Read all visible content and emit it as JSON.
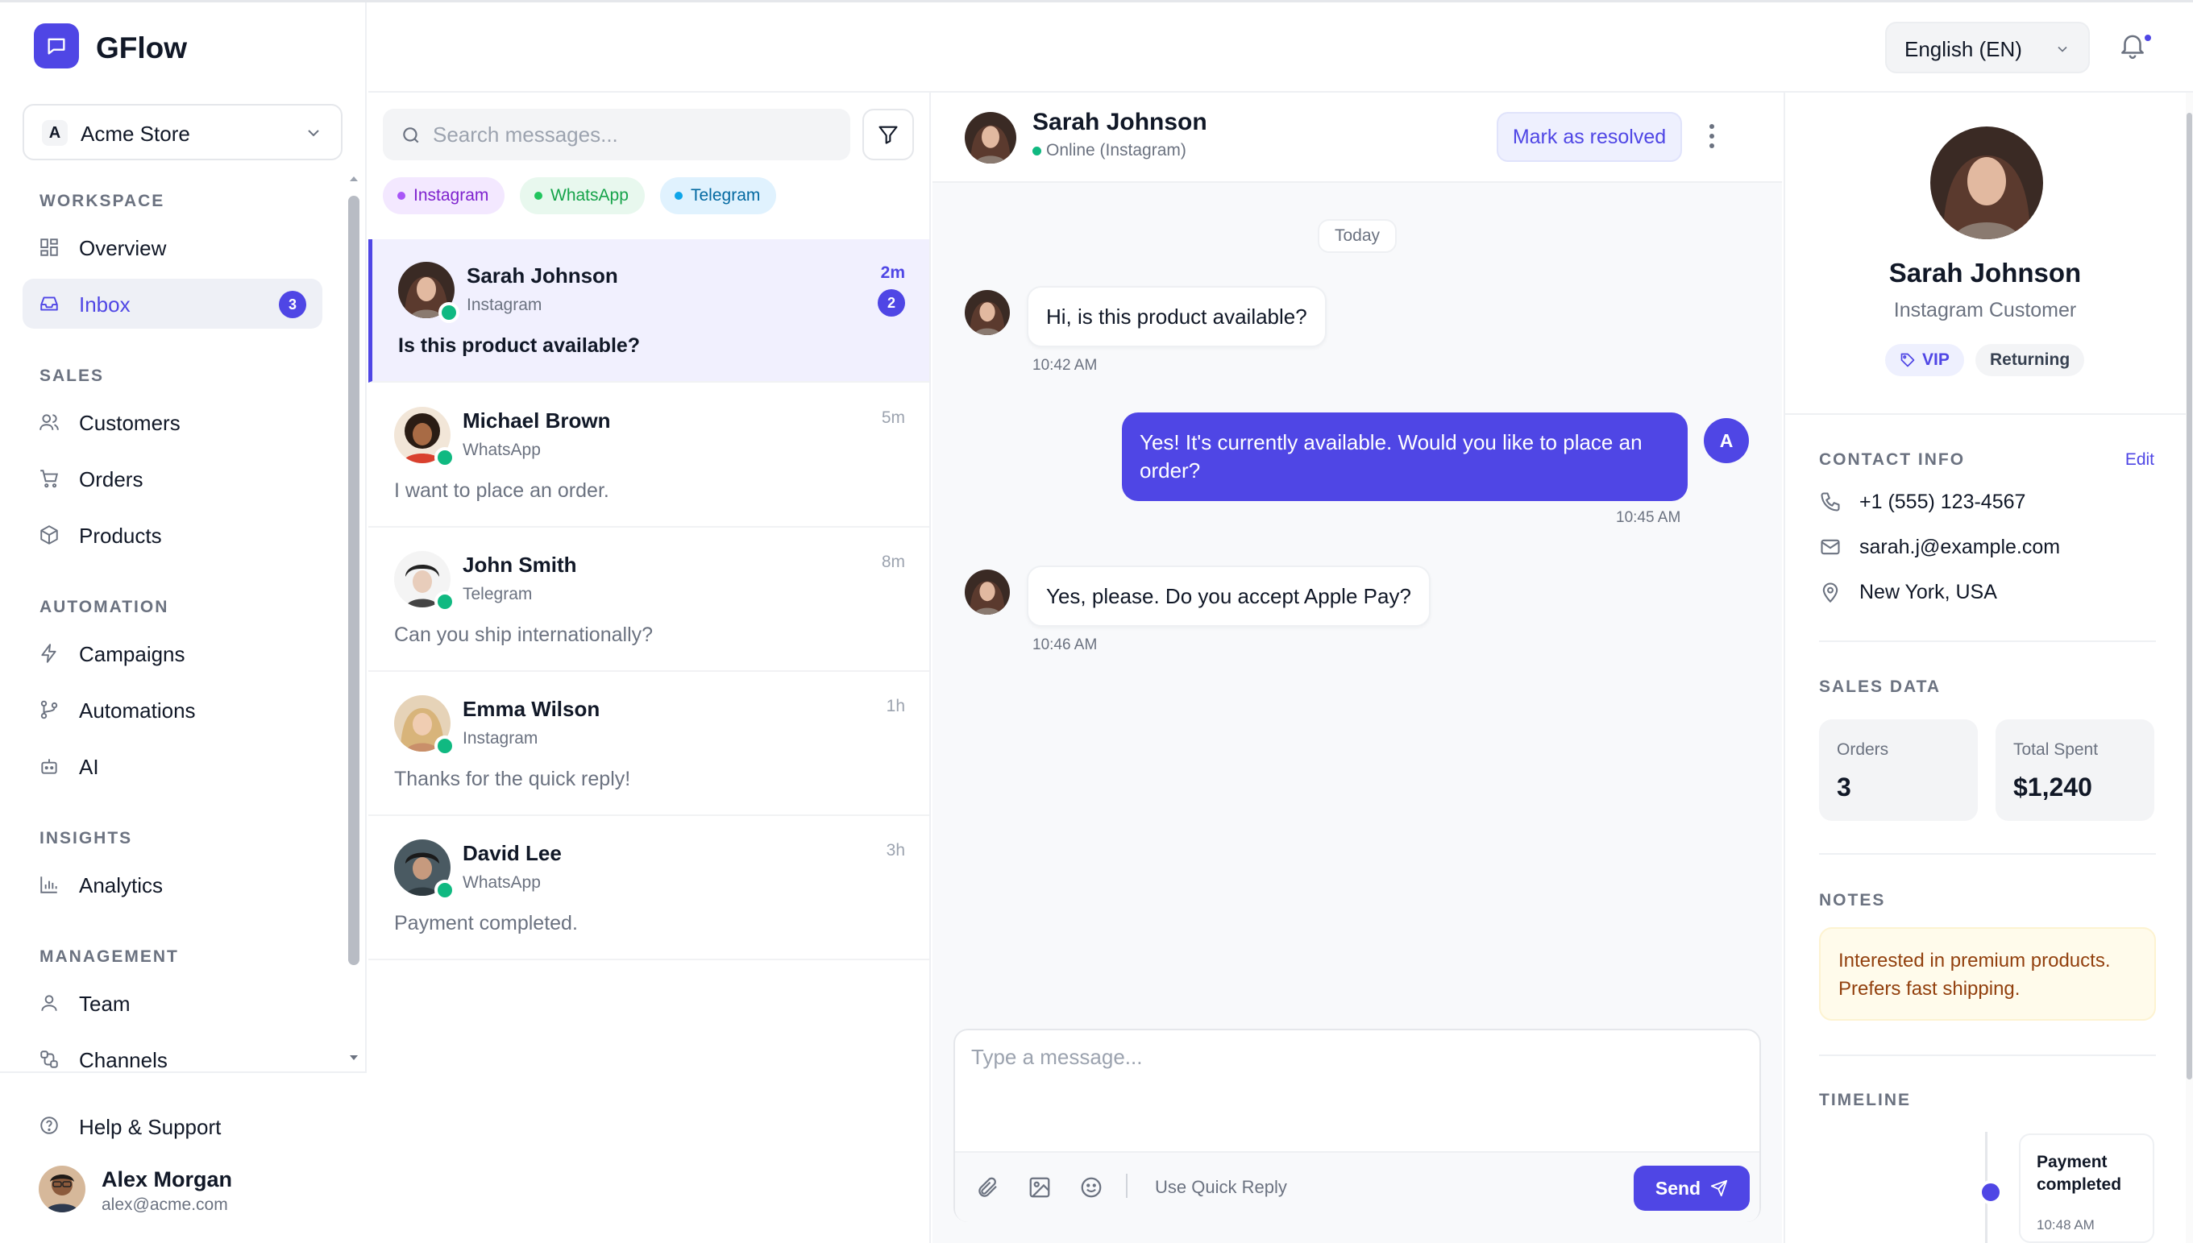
{
  "app": {
    "name": "GFlow"
  },
  "store": {
    "initial": "A",
    "name": "Acme Store"
  },
  "sidebar": {
    "sections": [
      {
        "title": "WORKSPACE",
        "items": [
          {
            "label": "Overview",
            "icon": "grid-icon"
          },
          {
            "label": "Inbox",
            "icon": "inbox-icon",
            "badge": "3",
            "active": true
          }
        ]
      },
      {
        "title": "SALES",
        "items": [
          {
            "label": "Customers",
            "icon": "users-icon"
          },
          {
            "label": "Orders",
            "icon": "cart-icon"
          },
          {
            "label": "Products",
            "icon": "box-icon"
          }
        ]
      },
      {
        "title": "AUTOMATION",
        "items": [
          {
            "label": "Campaigns",
            "icon": "lightning-icon"
          },
          {
            "label": "Automations",
            "icon": "branch-icon"
          },
          {
            "label": "AI",
            "icon": "bot-icon"
          }
        ]
      },
      {
        "title": "INSIGHTS",
        "items": [
          {
            "label": "Analytics",
            "icon": "bar-chart-icon"
          }
        ]
      },
      {
        "title": "MANAGEMENT",
        "items": [
          {
            "label": "Team",
            "icon": "user-icon"
          },
          {
            "label": "Channels",
            "icon": "channels-icon"
          }
        ]
      }
    ],
    "help_label": "Help & Support",
    "user": {
      "name": "Alex Morgan",
      "email": "alex@acme.com"
    }
  },
  "topbar": {
    "language": "English (EN)"
  },
  "inbox": {
    "search_placeholder": "Search messages...",
    "channels": [
      {
        "label": "Instagram",
        "color": "#a855f7",
        "bg": "#f3e8ff",
        "text": "#7e22ce"
      },
      {
        "label": "WhatsApp",
        "color": "#22c55e",
        "bg": "#e8f8ee",
        "text": "#16a34a"
      },
      {
        "label": "Telegram",
        "color": "#0ea5e9",
        "bg": "#e0f2fe",
        "text": "#0369a1"
      }
    ],
    "conversations": [
      {
        "name": "Sarah Johnson",
        "channel": "Instagram",
        "time": "2m",
        "unread": "2",
        "message": "Is this product available?",
        "active": true
      },
      {
        "name": "Michael Brown",
        "channel": "WhatsApp",
        "time": "5m",
        "message": "I want to place an order."
      },
      {
        "name": "John Smith",
        "channel": "Telegram",
        "time": "8m",
        "message": "Can you ship internationally?"
      },
      {
        "name": "Emma Wilson",
        "channel": "Instagram",
        "time": "1h",
        "message": "Thanks for the quick reply!"
      },
      {
        "name": "David Lee",
        "channel": "WhatsApp",
        "time": "3h",
        "message": "Payment completed."
      }
    ]
  },
  "chat": {
    "contact_name": "Sarah Johnson",
    "status": "Online (Instagram)",
    "resolve_label": "Mark as resolved",
    "date_divider": "Today",
    "messages": [
      {
        "from": "customer",
        "text": "Hi, is this product available?",
        "time": "10:42 AM"
      },
      {
        "from": "agent",
        "agent_initial": "A",
        "text": "Yes! It's currently available. Would you like to place an order?",
        "time": "10:45 AM"
      },
      {
        "from": "customer",
        "text": "Yes, please. Do you accept Apple Pay?",
        "time": "10:46 AM"
      }
    ],
    "composer_placeholder": "Type a message...",
    "quick_reply_label": "Use Quick Reply",
    "send_label": "Send"
  },
  "profile": {
    "name": "Sarah Johnson",
    "subtitle": "Instagram Customer",
    "tags": [
      "VIP",
      "Returning"
    ],
    "contact_title": "CONTACT INFO",
    "edit_label": "Edit",
    "phone": "+1 (555) 123-4567",
    "email": "sarah.j@example.com",
    "location": "New York, USA",
    "sales_title": "SALES DATA",
    "stats": [
      {
        "label": "Orders",
        "value": "3"
      },
      {
        "label": "Total Spent",
        "value": "$1,240"
      }
    ],
    "notes_title": "NOTES",
    "notes": "Interested in premium products. Prefers fast shipping.",
    "timeline_title": "TIMELINE",
    "timeline": [
      {
        "title": "Payment completed",
        "time": "10:48 AM"
      }
    ]
  },
  "colors": {
    "accent": "#4f46e5",
    "online": "#10b981"
  }
}
